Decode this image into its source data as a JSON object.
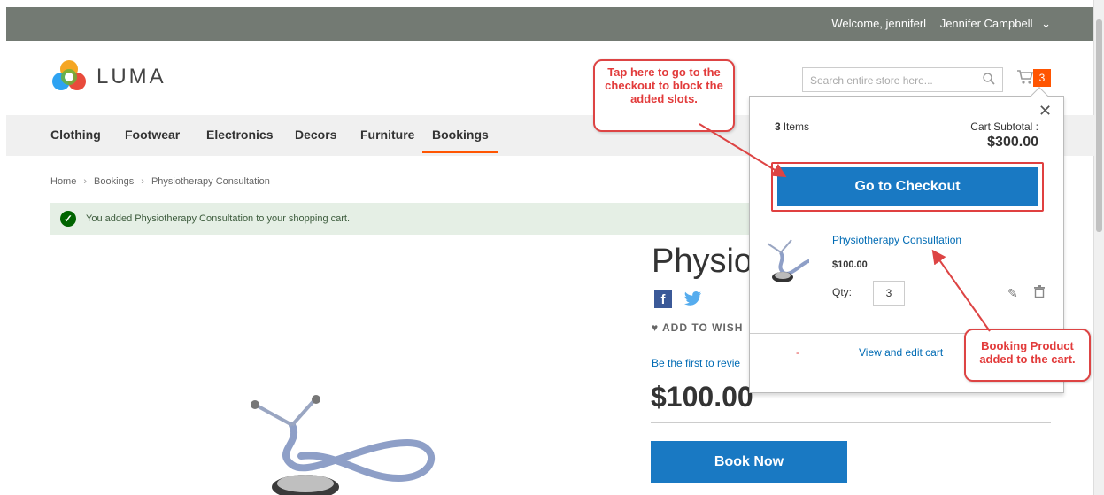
{
  "header": {
    "welcome": "Welcome, jenniferl",
    "user": "Jennifer Campbell"
  },
  "logo": {
    "text": "LUMA"
  },
  "search": {
    "placeholder": "Search entire store here..."
  },
  "cart": {
    "count": "3"
  },
  "nav": {
    "items": [
      "Clothing",
      "Footwear",
      "Electronics",
      "Decors",
      "Furniture",
      "Bookings"
    ]
  },
  "breadcrumb": {
    "items": [
      "Home",
      "Bookings",
      "Physiotherapy Consultation"
    ]
  },
  "message": "You added Physiotherapy Consultation to your shopping cart.",
  "product": {
    "title": "Physiot",
    "add_to_wishlist": "ADD TO WISH",
    "review": "Be the first to revie",
    "price": "$100.00",
    "book_now": "Book Now"
  },
  "minicart": {
    "items_count": "3",
    "items_label": "Items",
    "subtotal_label": "Cart Subtotal :",
    "subtotal_value": "$300.00",
    "checkout": "Go to Checkout",
    "item": {
      "name": "Physiotherapy Consultation",
      "price": "$100.00",
      "qty_label": "Qty:",
      "qty": "3"
    },
    "view_edit": "View and edit cart",
    "dash": "-"
  },
  "callouts": {
    "checkout": "Tap here to go to the checkout to block the added slots.",
    "booking": "Booking Product added to the cart."
  },
  "colors": {
    "accent": "#ff5501",
    "primary": "#1979c3",
    "callout": "#e23b3b",
    "topbar": "#737a73"
  }
}
